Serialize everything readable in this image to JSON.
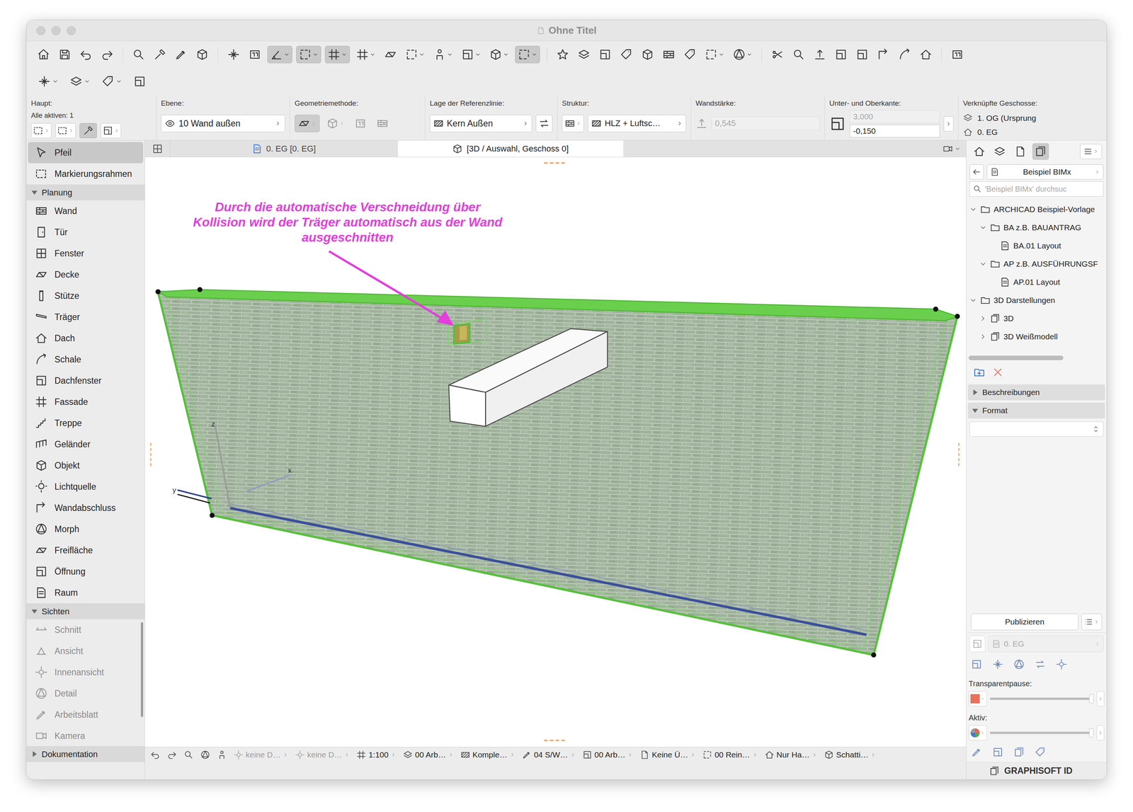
{
  "window": {
    "title": "Ohne Titel"
  },
  "toolbar": {
    "rows": [
      [
        {
          "pressed": false,
          "dropdown": false
        },
        {
          "pressed": false,
          "dropdown": false
        },
        {
          "pressed": false,
          "dropdown": false
        },
        {
          "pressed": false,
          "dropdown": false
        },
        {
          "pressed": false,
          "dropdown": false
        },
        {
          "pressed": false,
          "dropdown": false
        },
        {
          "pressed": false,
          "dropdown": false
        },
        {
          "pressed": false,
          "dropdown": false
        },
        {
          "pressed": false,
          "dropdown": false
        },
        {
          "pressed": false,
          "dropdown": false
        },
        {
          "pressed": true,
          "dropdown": true
        },
        {
          "pressed": true,
          "dropdown": true
        },
        {
          "pressed": true,
          "dropdown": true
        },
        {
          "pressed": false,
          "dropdown": true
        },
        {
          "pressed": false,
          "dropdown": false
        },
        {
          "pressed": false,
          "dropdown": true
        },
        {
          "pressed": false,
          "dropdown": true
        },
        {
          "pressed": false,
          "dropdown": true
        },
        {
          "pressed": false,
          "dropdown": true
        },
        {
          "pressed": true,
          "dropdown": true
        },
        {
          "pressed": false,
          "dropdown": false
        },
        {
          "pressed": false,
          "dropdown": false
        },
        {
          "pressed": false,
          "dropdown": false
        },
        {
          "pressed": false,
          "dropdown": false
        },
        {
          "pressed": false,
          "dropdown": false
        },
        {
          "pressed": false,
          "dropdown": false
        },
        {
          "pressed": false,
          "dropdown": false
        },
        {
          "pressed": false,
          "dropdown": true
        },
        {
          "pressed": false,
          "dropdown": true
        },
        {
          "pressed": false,
          "dropdown": false
        },
        {
          "pressed": false,
          "dropdown": false
        },
        {
          "pressed": false,
          "dropdown": false
        },
        {
          "pressed": false,
          "dropdown": false
        },
        {
          "pressed": false,
          "dropdown": false
        },
        {
          "pressed": false,
          "dropdown": false
        },
        {
          "pressed": false,
          "dropdown": false
        },
        {
          "pressed": false,
          "dropdown": false
        },
        {
          "pressed": false,
          "dropdown": false
        }
      ],
      [
        {
          "pressed": false,
          "dropdown": true
        },
        {
          "pressed": false,
          "dropdown": true
        },
        {
          "pressed": false,
          "dropdown": true
        },
        {
          "pressed": false,
          "dropdown": false
        }
      ]
    ]
  },
  "info_box": {
    "haupt": {
      "label": "Haupt:",
      "active": "Alle aktiven: 1",
      "magic_wand": {
        "pressed": true
      }
    },
    "ebene": {
      "label": "Ebene:",
      "value": "10 Wand außen"
    },
    "geometrie": {
      "label": "Geometriemethode:",
      "methods": [
        {
          "selected": true
        },
        {
          "selected": false
        },
        {
          "selected": false
        },
        {
          "selected": false
        }
      ]
    },
    "referenzlinie": {
      "label": "Lage der Referenzlinie:",
      "value": "Kern Außen"
    },
    "struktur": {
      "label": "Struktur:",
      "value": "HLZ + Luftsc…"
    },
    "wandstaerke": {
      "label": "Wandstärke:",
      "value": "0,545",
      "disabled": true
    },
    "kanten": {
      "label": "Unter- und Oberkante:",
      "top": "3,000",
      "top_disabled": true,
      "bottom": "-0,150"
    },
    "geschosse": {
      "label": "Verknüpfte Geschosse:",
      "top": "1. OG (Ursprung",
      "bottom": "0. EG"
    }
  },
  "tabs": [
    {
      "label": "0. EG [0. EG]",
      "selected": false,
      "kind": "plan"
    },
    {
      "label": "[3D / Auswahl, Geschoss 0]",
      "selected": true,
      "kind": "3d"
    }
  ],
  "toolbox": {
    "top_items": [
      {
        "label": "Pfeil",
        "selected": true
      },
      {
        "label": "Markierungsrahmen",
        "selected": false
      }
    ],
    "groups": [
      {
        "label": "Planung",
        "expanded": true,
        "items": [
          {
            "label": "Wand",
            "disabled": false
          },
          {
            "label": "Tür",
            "disabled": false
          },
          {
            "label": "Fenster",
            "disabled": false
          },
          {
            "label": "Decke",
            "disabled": false
          },
          {
            "label": "Stütze",
            "disabled": false
          },
          {
            "label": "Träger",
            "disabled": false
          },
          {
            "label": "Dach",
            "disabled": false
          },
          {
            "label": "Schale",
            "disabled": false
          },
          {
            "label": "Dachfenster",
            "disabled": false
          },
          {
            "label": "Fassade",
            "disabled": false
          },
          {
            "label": "Treppe",
            "disabled": false
          },
          {
            "label": "Geländer",
            "disabled": false
          },
          {
            "label": "Objekt",
            "disabled": false
          },
          {
            "label": "Lichtquelle",
            "disabled": false
          },
          {
            "label": "Wandabschluss",
            "disabled": false
          },
          {
            "label": "Morph",
            "disabled": false
          },
          {
            "label": "Freifläche",
            "disabled": false
          },
          {
            "label": "Öffnung",
            "disabled": false
          },
          {
            "label": "Raum",
            "disabled": false
          }
        ]
      },
      {
        "label": "Sichten",
        "expanded": true,
        "items": [
          {
            "label": "Schnitt",
            "disabled": true
          },
          {
            "label": "Ansicht",
            "disabled": true
          },
          {
            "label": "Innenansicht",
            "disabled": true
          },
          {
            "label": "Detail",
            "disabled": true
          },
          {
            "label": "Arbeitsblatt",
            "disabled": true
          },
          {
            "label": "Kamera",
            "disabled": true
          }
        ]
      },
      {
        "label": "Dokumentation",
        "expanded": false,
        "items": []
      }
    ]
  },
  "canvas": {
    "annotation": [
      "Durch die automatische Verschneidung über",
      "Kollision wird der Träger automatisch aus der Wand",
      "ausgeschnitten"
    ],
    "axis_labels": [
      "z",
      "y",
      "x"
    ]
  },
  "status_bar": [
    {
      "label": "keine D…",
      "disabled": true
    },
    {
      "label": "keine D…",
      "disabled": true
    },
    {
      "label": "1:100",
      "disabled": false
    },
    {
      "label": "00 Arb…",
      "disabled": false
    },
    {
      "label": "Komple…",
      "disabled": false
    },
    {
      "label": "04 S/W…",
      "disabled": false
    },
    {
      "label": "00 Arb…",
      "disabled": false
    },
    {
      "label": "Keine Ü…",
      "disabled": false
    },
    {
      "label": "00 Rein…",
      "disabled": false
    },
    {
      "label": "Nur Ha…",
      "disabled": false
    },
    {
      "label": "Schatti…",
      "disabled": false
    }
  ],
  "navigator": {
    "modes": [
      {
        "selected": false
      },
      {
        "selected": false
      },
      {
        "selected": false
      },
      {
        "selected": true
      }
    ],
    "set": "Beispiel BIMx",
    "search_placeholder": "'Beispiel BIMx' durchsuc",
    "tree": [
      {
        "label": "ARCHICAD Beispiel-Vorlage",
        "kind": "folder",
        "expanded": true,
        "children": [
          {
            "label": "BA z.B. BAUANTRAG",
            "kind": "folder",
            "expanded": true,
            "children": [
              {
                "label": "BA.01 Layout",
                "kind": "layout",
                "children": []
              }
            ]
          },
          {
            "label": "AP z.B. AUSFÜHRUNGSF",
            "kind": "folder",
            "expanded": true,
            "children": [
              {
                "label": "AP.01 Layout",
                "kind": "layout",
                "children": []
              }
            ]
          }
        ]
      },
      {
        "label": "3D Darstellungen",
        "kind": "folder",
        "expanded": true,
        "children": [
          {
            "label": "3D",
            "kind": "view",
            "expanded": false,
            "children": []
          },
          {
            "label": "3D Weißmodell",
            "kind": "view",
            "expanded": false,
            "children": []
          }
        ]
      }
    ],
    "sections": [
      {
        "label": "Beschreibungen",
        "expanded": false
      },
      {
        "label": "Format",
        "expanded": true
      }
    ],
    "publish": "Publizieren",
    "floor": "0. EG",
    "floor_disabled": true,
    "sliders": [
      {
        "label": "Transparentpause:",
        "level": 1.0,
        "kind": "swatch"
      },
      {
        "label": "Aktiv:",
        "level": 1.0,
        "kind": "pie"
      }
    ],
    "brand": "GRAPHISOFT ID"
  }
}
